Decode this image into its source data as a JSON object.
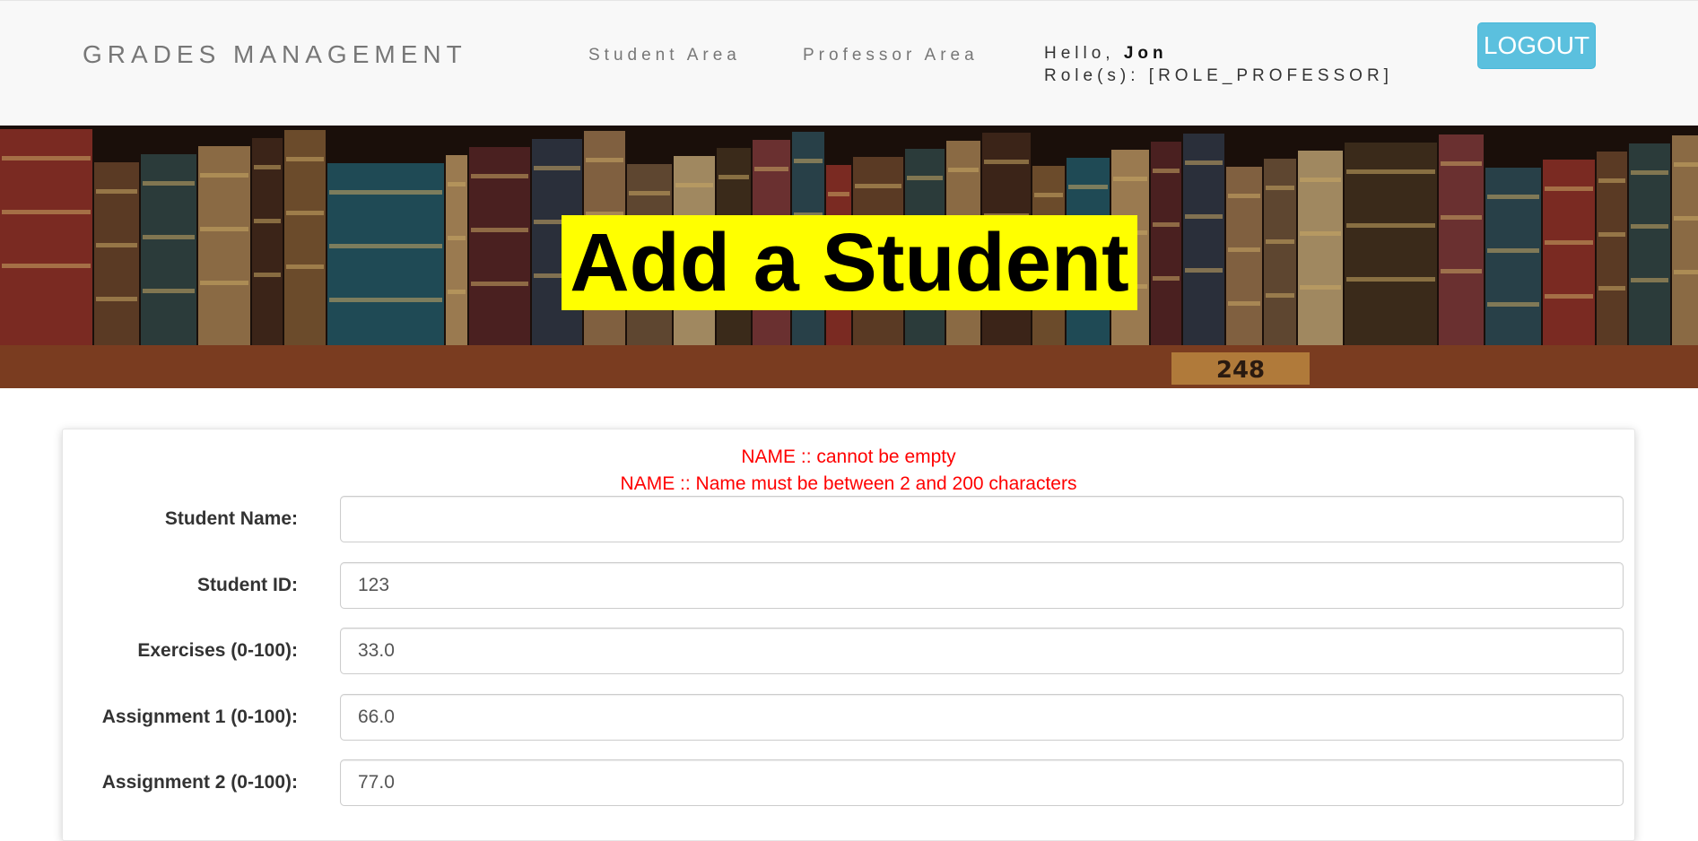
{
  "navbar": {
    "brand": "GRADES MANAGEMENT",
    "links": [
      {
        "label": "Student Area"
      },
      {
        "label": "Professor Area"
      }
    ],
    "greeting": "Hello,",
    "username": "Jon",
    "roles_label": "Role(s):",
    "roles_value": "[ROLE_PROFESSOR]",
    "logout_label": "LOGOUT"
  },
  "banner": {
    "title": "Add a Student",
    "shelf_label": "248"
  },
  "form": {
    "errors": [
      "NAME :: cannot be empty",
      "NAME :: Name must be between 2 and 200 characters"
    ],
    "fields": [
      {
        "label": "Student Name:",
        "value": ""
      },
      {
        "label": "Student ID:",
        "value": "123"
      },
      {
        "label": "Exercises (0-100):",
        "value": "33.0"
      },
      {
        "label": "Assignment 1 (0-100):",
        "value": "66.0"
      },
      {
        "label": "Assignment 2 (0-100):",
        "value": "77.0"
      }
    ]
  },
  "colors": {
    "navbar_bg": "#f8f8f8",
    "logout_bg": "#5bc0de",
    "title_highlight": "#ffff00",
    "error_text": "#ff0000"
  }
}
